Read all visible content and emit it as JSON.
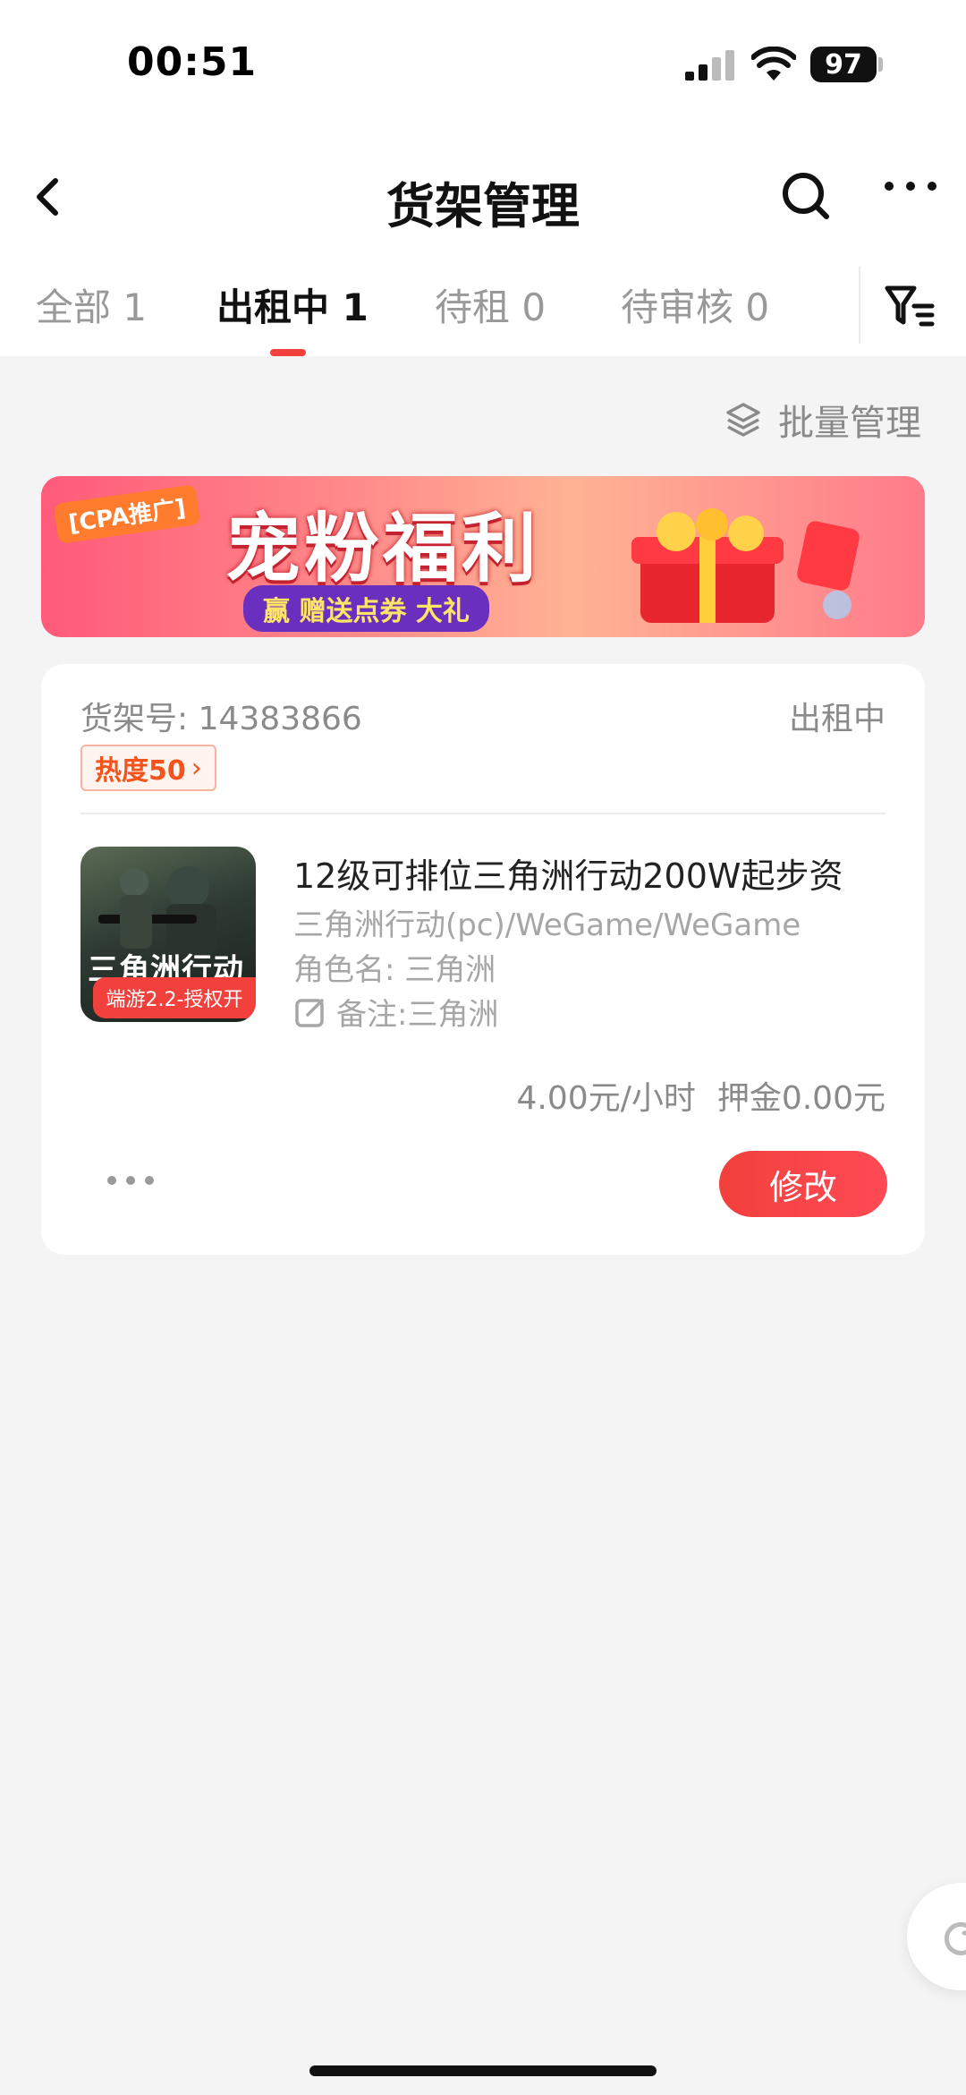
{
  "status_bar": {
    "time": "00:51",
    "battery": "97"
  },
  "nav": {
    "title": "货架管理"
  },
  "tabs": [
    {
      "label": "全部 1",
      "active": false
    },
    {
      "label": "出租中 1",
      "active": true
    },
    {
      "label": "待租 0",
      "active": false
    },
    {
      "label": "待审核 0",
      "active": false
    }
  ],
  "batch_manage_label": "批量管理",
  "banner": {
    "tag": "[CPA推广]",
    "title": "宠粉福利",
    "subtitle": "赢 赠送点券 大礼"
  },
  "listing": {
    "shelf_number": "货架号: 14383866",
    "status": "出租中",
    "heat": "热度50",
    "thumb_title": "三角洲行动",
    "thumb_label": "端游2.2-授权开",
    "title": "12级可排位三角洲行动200W起步资",
    "platform": "三角洲行动(pc)/WeGame/WeGame",
    "role_name": "角色名: 三角洲",
    "note": "备注:三角洲",
    "price": "4.00元/小时",
    "deposit": "押金0.00元",
    "modify_label": "修改"
  },
  "colors": {
    "accent": "#f2403c",
    "heat_text": "#f2541b",
    "muted_text": "#8a8a8a"
  },
  "icons": [
    "back-icon",
    "search-icon",
    "more-icon",
    "filter-icon",
    "layers-icon",
    "edit-note-icon",
    "refresh-icon"
  ]
}
